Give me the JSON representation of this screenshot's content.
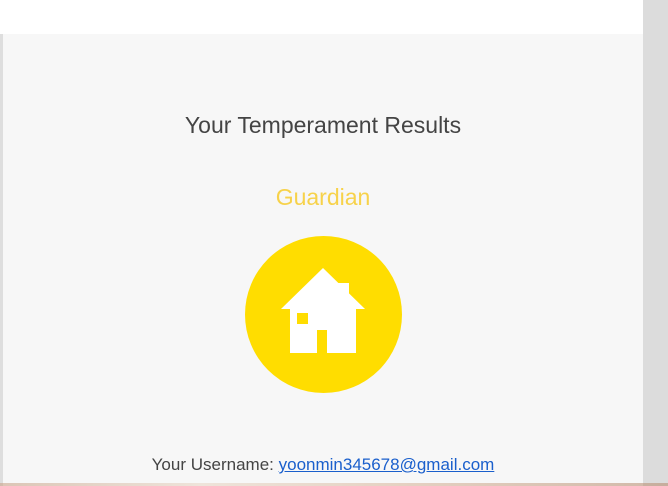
{
  "results": {
    "heading": "Your Temperament Results",
    "temperament": "Guardian",
    "icon": "house-icon",
    "badge_color": "#ffdd00",
    "temperament_color": "#f7d24a"
  },
  "user": {
    "label": "Your Username:",
    "email": "yoonmin345678@gmail.com"
  }
}
